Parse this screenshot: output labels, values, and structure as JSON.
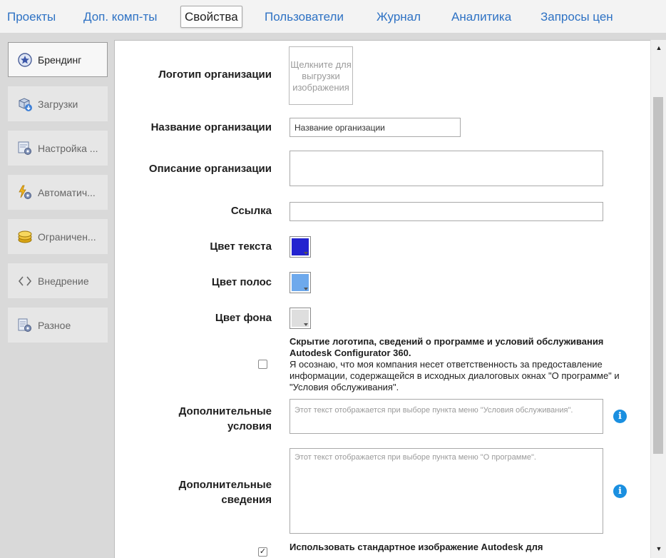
{
  "top_tabs": [
    {
      "label": "Проекты"
    },
    {
      "label": "Доп. комп-ты"
    },
    {
      "label": "Свойства",
      "active": true
    },
    {
      "label": "Пользователи"
    },
    {
      "label": "Журнал"
    },
    {
      "label": "Аналитика"
    },
    {
      "label": "Запросы цен"
    }
  ],
  "sidebar": {
    "items": [
      {
        "label": "Брендинг",
        "icon": "star-icon",
        "active": true
      },
      {
        "label": "Загрузки",
        "icon": "download-box-icon"
      },
      {
        "label": "Настройка ...",
        "icon": "settings-gear-icon"
      },
      {
        "label": "Автоматич...",
        "icon": "automation-icon"
      },
      {
        "label": "Ограничен...",
        "icon": "coins-icon"
      },
      {
        "label": "Внедрение",
        "icon": "embed-code-icon"
      },
      {
        "label": "Разное",
        "icon": "misc-gear-icon"
      }
    ]
  },
  "form": {
    "logo_label": "Логотип организации",
    "logo_placeholder": "Щелкните для выгрузки изображения",
    "org_name_label": "Название организации",
    "org_name_value": "Название организации",
    "org_desc_label": "Описание организации",
    "link_label": "Ссылка",
    "text_color_label": "Цвет текста",
    "stripe_color_label": "Цвет полос",
    "bg_color_label": "Цвет фона",
    "hide_title": "Скрытие логотипа, сведений о программе и условий обслуживания Autodesk Configurator 360.",
    "hide_desc": "Я осознаю, что моя компания несет ответственность за предоставление информации, содержащейся в исходных диалоговых окнах \"О программе\" и \"Условия обслуживания\".",
    "extra_terms_label_1": "Дополнительные",
    "extra_terms_label_2": "условия",
    "extra_terms_placeholder": "Этот текст отображается при выборе пункта меню \"Условия обслуживания\".",
    "extra_info_label_1": "Дополнительные",
    "extra_info_label_2": "сведения",
    "extra_info_placeholder": "Этот текст отображается при выборе пункта меню \"О программе\".",
    "use_default_image": "Использовать стандартное изображение Autodesk для"
  },
  "colors": {
    "text_color": "#2323cf",
    "stripe_color": "#6ea9ec",
    "bg_color": "#dedede",
    "accent": "#2e72c4",
    "info": "#1a8fe0"
  },
  "state": {
    "hide_checkbox_checked": false,
    "default_image_checked": true
  }
}
